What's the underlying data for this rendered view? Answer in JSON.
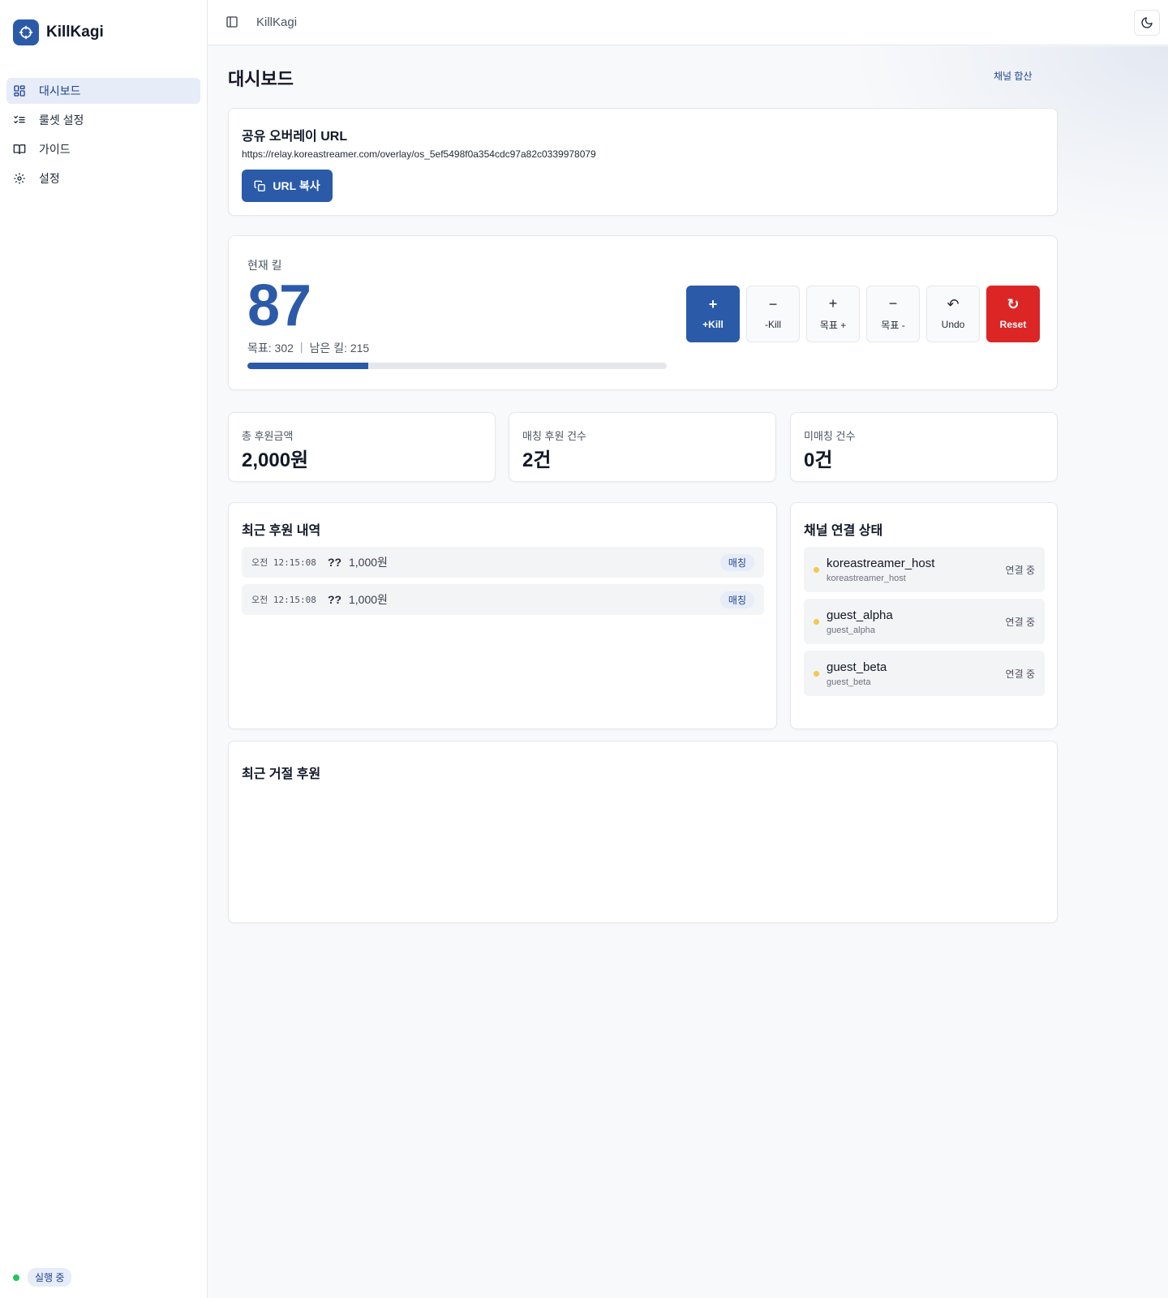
{
  "app": {
    "name": "KillKagi"
  },
  "sidebar": {
    "items": [
      {
        "label": "대시보드",
        "icon": "dashboard-icon",
        "active": true
      },
      {
        "label": "룰셋 설정",
        "icon": "list-check-icon",
        "active": false
      },
      {
        "label": "가이드",
        "icon": "book-icon",
        "active": false
      },
      {
        "label": "설정",
        "icon": "gear-icon",
        "active": false
      }
    ],
    "status_label": "실행 중",
    "status_color": "#22c55e"
  },
  "topbar": {
    "title": "KillKagi"
  },
  "page": {
    "title": "대시보드",
    "channel_sum_label": "채널 합산"
  },
  "overlay": {
    "title": "공유 오버레이 URL",
    "url": "https://relay.koreastreamer.com/overlay/os_5ef5498f0a354cdc97a82c0339978079",
    "copy_label": "URL 복사"
  },
  "kills": {
    "label": "현재 킬",
    "count": "87",
    "goal_text": "목표: 302",
    "separator": "|",
    "remaining_text": "남은 킬: 215",
    "progress_fraction": 0.288,
    "buttons": [
      {
        "glyph": "+",
        "label": "+Kill",
        "style": "primary"
      },
      {
        "glyph": "−",
        "label": "-Kill",
        "style": "default"
      },
      {
        "glyph": "+",
        "label": "목표 +",
        "style": "default"
      },
      {
        "glyph": "−",
        "label": "목표 -",
        "style": "default"
      },
      {
        "glyph": "↶",
        "label": "Undo",
        "style": "default"
      },
      {
        "glyph": "↻",
        "label": "Reset",
        "style": "danger"
      }
    ]
  },
  "stats": [
    {
      "label": "총 후원금액",
      "value": "2,000원"
    },
    {
      "label": "매칭 후원 건수",
      "value": "2건"
    },
    {
      "label": "미매칭 건수",
      "value": "0건"
    }
  ],
  "recent_donations": {
    "title": "최근 후원 내역",
    "rows": [
      {
        "time": "오전 12:15:08",
        "name": "??",
        "amount": "1,000원",
        "badge": "매칭"
      },
      {
        "time": "오전 12:15:08",
        "name": "??",
        "amount": "1,000원",
        "badge": "매칭"
      }
    ]
  },
  "channels": {
    "title": "채널 연결 상태",
    "rows": [
      {
        "name": "koreastreamer_host",
        "id": "koreastreamer_host",
        "state": "연결 중"
      },
      {
        "name": "guest_alpha",
        "id": "guest_alpha",
        "state": "연결 중"
      },
      {
        "name": "guest_beta",
        "id": "guest_beta",
        "state": "연결 중"
      }
    ]
  },
  "rejected": {
    "title": "최근 거절 후원"
  },
  "colors": {
    "accent": "#2b5aa8",
    "danger": "#dc2626",
    "connecting_dot": "#f2c94c"
  }
}
